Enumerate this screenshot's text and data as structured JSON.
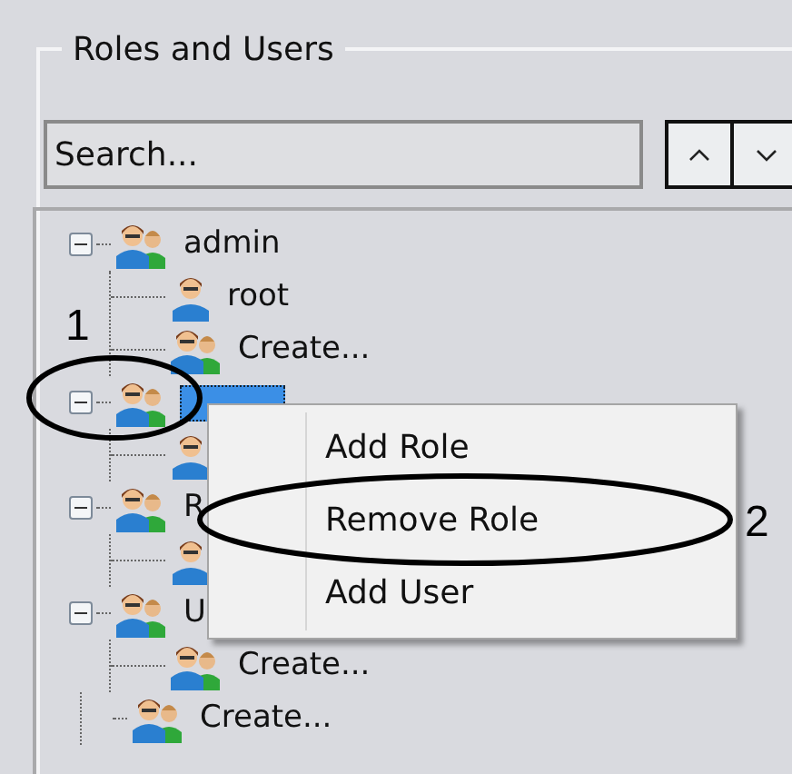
{
  "group": {
    "title": "Roles and Users"
  },
  "search": {
    "placeholder": "Search..."
  },
  "nav_buttons": [
    {
      "kind": "up"
    },
    {
      "kind": "down"
    }
  ],
  "tree": [
    {
      "label": "admin",
      "kind": "role",
      "expanded": true,
      "selected": false,
      "children": [
        {
          "label": "root",
          "kind": "user",
          "selected": false
        },
        {
          "label": "Create...",
          "kind": "role",
          "selected": false
        }
      ]
    },
    {
      "kind": "role",
      "expanded": true,
      "selected": true,
      "children": [
        {
          "kind": "user",
          "selected": false
        }
      ]
    },
    {
      "label": "R",
      "kind": "role",
      "expanded": true,
      "selected": false,
      "children": [
        {
          "kind": "user",
          "selected": false
        }
      ]
    },
    {
      "label": "U",
      "kind": "role",
      "expanded": true,
      "selected": false,
      "children": [
        {
          "label": "Create...",
          "kind": "role",
          "selected": false
        }
      ]
    },
    {
      "label": "Create...",
      "kind": "role",
      "selected": false
    }
  ],
  "context_menu": [
    {
      "label": "Add Role"
    },
    {
      "label": "Remove Role"
    },
    {
      "label": "Add User"
    }
  ],
  "annotations": [
    {
      "label": "1"
    },
    {
      "label": "2"
    }
  ]
}
